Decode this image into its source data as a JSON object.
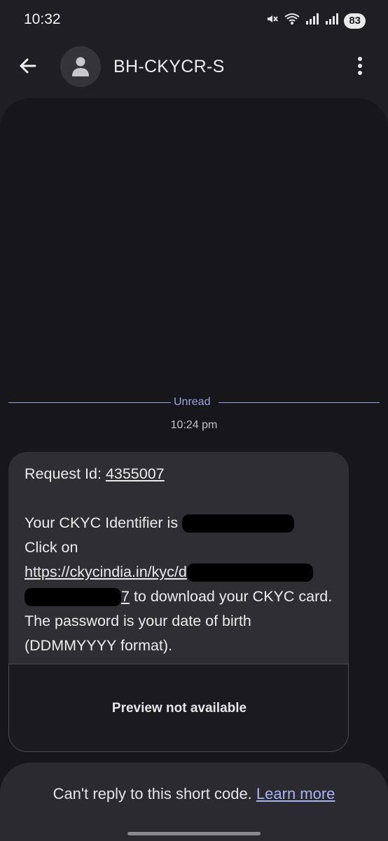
{
  "status_bar": {
    "time": "10:32",
    "battery": "83",
    "icons": [
      "mute-icon",
      "wifi-icon",
      "signal-icon",
      "signal-icon"
    ]
  },
  "header": {
    "contact_name": "BH-CKYCR-S",
    "back_icon": "arrow-back-icon",
    "avatar_icon": "person-icon",
    "menu_icon": "more-vertical-icon"
  },
  "thread": {
    "unread_label": "Unread",
    "timestamp": "10:24 pm",
    "message": {
      "request_prefix": "Request Id: ",
      "request_id": "4355007",
      "identifier_prefix": "Your CKYC Identifier is ",
      "click_on": "Click on",
      "link_visible": "https://ckycindia.in/kyc/d",
      "link_tail": "7",
      "download_text": " to download your CKYC card. The password is your date of birth (DDMMYYYY format).",
      "preview_label": "Preview not available"
    }
  },
  "footer": {
    "text": "Can't reply to this short code. ",
    "learn_more": "Learn more"
  },
  "colors": {
    "accent": "#9aa6d8",
    "link": "#a9b6ee",
    "background": "#16161b",
    "bubble": "#2e2e33"
  }
}
